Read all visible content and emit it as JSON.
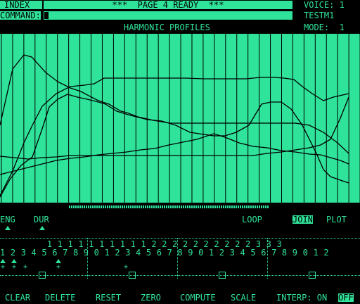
{
  "header": {
    "index_label": "INDEX",
    "status": "***  PAGE 4 READY  ***",
    "voice": "VOICE: 1",
    "command_label": "COMMAND:",
    "patch_name": "TESTM1",
    "plot_title": "HARMONIC PROFILES",
    "mode": "MODE:  1"
  },
  "options": {
    "eng": "ENG",
    "dur": "DUR",
    "loop": "LOOP",
    "join": "JOIN",
    "plot": "PLOT"
  },
  "harmonics": {
    "row_top": "         1 1 1 1 1 1 1 1 1 1 2 2 2 2 2 2 2 2 2 2 3 3 3",
    "row_bottom": "1 2 3 4 5 6 7 8 9 0 1 2 3 4 5 6 7 8 9 0 1 2 3 4 5 6 7 8 9 0 1 2"
  },
  "commands": {
    "clear": "CLEAR",
    "delete": "DELETE",
    "reset": "RESET",
    "zero": "ZERO",
    "compute": "COMPUTE",
    "scale": "SCALE",
    "interp_label": "INTERP: ON",
    "interp_off": "OFF"
  },
  "colors": {
    "phosphor": "#2fe39a",
    "background": "#000000"
  }
}
